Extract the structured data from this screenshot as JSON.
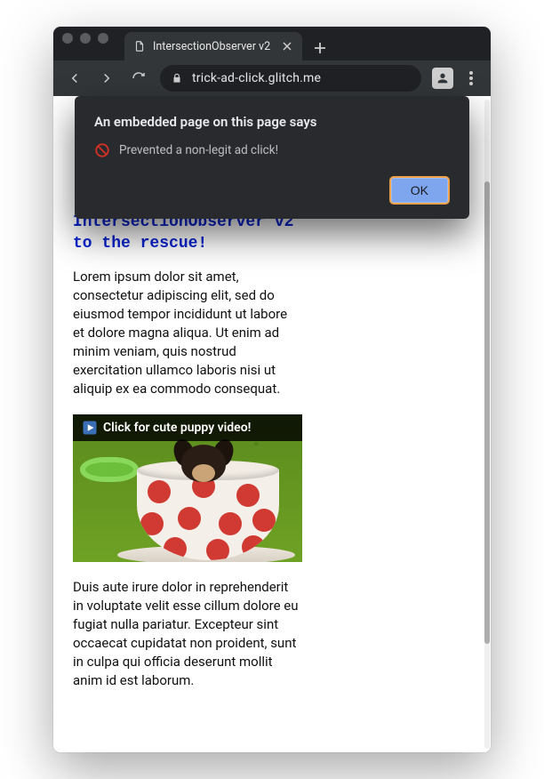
{
  "browser": {
    "tab_title": "IntersectionObserver v2",
    "url_display": "trick-ad-click.glitch.me"
  },
  "dialog": {
    "title": "An embedded page on this page says",
    "message": "Prevented a non-legit ad click!",
    "ok_label": "OK"
  },
  "page": {
    "heading": "IntersectionObserver v2 to the rescue!",
    "paragraph1": "Lorem ipsum dolor sit amet, consectetur adipiscing elit, sed do eiusmod tempor incididunt ut labore et dolore magna aliqua. Ut enim ad minim veniam, quis nostrud exercitation ullamco laboris nisi ut aliquip ex ea commodo consequat.",
    "ad_caption": "Click for cute puppy video!",
    "paragraph2": "Duis aute irure dolor in reprehenderit in voluptate velit esse cillum dolore eu fugiat nulla pariatur. Excepteur sint occaecat cupidatat non proident, sunt in culpa qui officia deserunt mollit anim id est laborum."
  }
}
